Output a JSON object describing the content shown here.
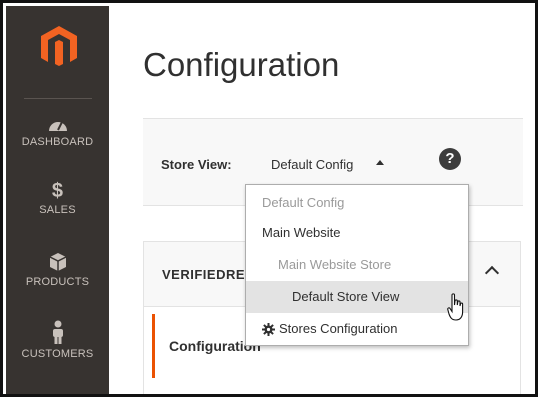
{
  "sidebar": {
    "items": [
      {
        "label": "DASHBOARD",
        "icon": "dashboard-icon"
      },
      {
        "label": "SALES",
        "icon": "dollar-icon"
      },
      {
        "label": "PRODUCTS",
        "icon": "box-icon"
      },
      {
        "label": "CUSTOMERS",
        "icon": "person-icon"
      }
    ]
  },
  "page": {
    "title": "Configuration"
  },
  "scope": {
    "label": "Store View:",
    "value": "Default Config",
    "help": "?"
  },
  "section": {
    "title": "VERIFIEDRE",
    "tab": "Configuration"
  },
  "dropdown": {
    "items": [
      {
        "label": "Default Config"
      },
      {
        "label": "Main Website"
      },
      {
        "label": "Main Website Store"
      },
      {
        "label": "Default Store View"
      },
      {
        "label": "Stores Configuration"
      }
    ]
  },
  "colors": {
    "sidebar_bg": "#373330",
    "brand_orange": "#eb5202",
    "highlight": "#e3e3e3"
  }
}
